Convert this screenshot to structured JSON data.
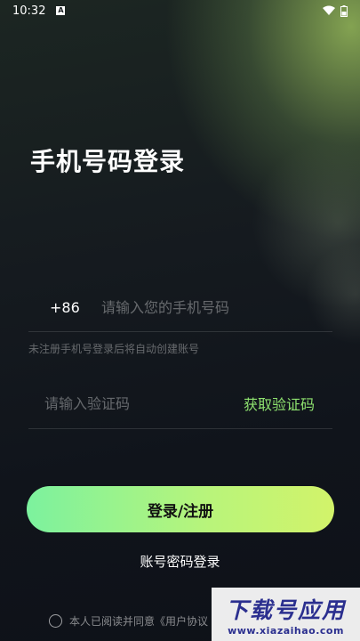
{
  "status_bar": {
    "time": "10:32",
    "notification_icon": "a-icon",
    "wifi_icon": "wifi-icon",
    "battery_icon": "battery-icon"
  },
  "login": {
    "title": "手机号码登录",
    "country_code": "+86",
    "phone_placeholder": "请输入您的手机号码",
    "hint": "未注册手机号登录后将自动创建账号",
    "code_placeholder": "请输入验证码",
    "get_code_label": "获取验证码",
    "submit_label": "登录/注册",
    "password_login_label": "账号密码登录",
    "agreement_text": "本人已阅读并同意《用户协议"
  },
  "watermark": {
    "title": "下载号应用",
    "url": "www.xiazaihao.com"
  },
  "colors": {
    "accent_green": "#8ee26f",
    "button_gradient_start": "#7cf29e",
    "button_gradient_end": "#d2f36a"
  }
}
